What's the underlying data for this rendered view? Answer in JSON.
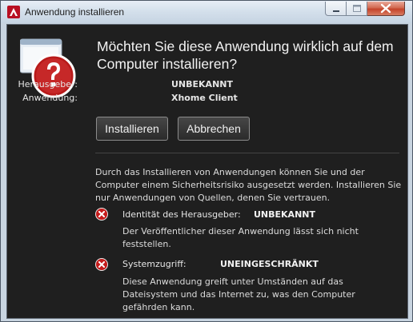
{
  "window": {
    "title": "Anwendung installieren"
  },
  "dialog": {
    "headline": "Möchten Sie diese Anwendung wirklich auf dem Computer installieren?",
    "publisher_label": "Herausgeber:",
    "publisher_value": "UNBEKANNT",
    "application_label": "Anwendung:",
    "application_value": "Xhome Client",
    "install_button": "Installieren",
    "cancel_button": "Abbrechen",
    "risk_text": "Durch das Installieren von Anwendungen können Sie und der Computer einem Sicherheitsrisiko ausgesetzt werden. Installieren Sie nur Anwendungen von Quellen, denen Sie vertrauen.",
    "warnings": [
      {
        "title": "Identität des Herausgeber:",
        "value": "UNBEKANNT",
        "description": "Der Veröffentlicher dieser Anwendung lässt sich nicht feststellen."
      },
      {
        "title": "Systemzugriff:",
        "value": "UNEINGESCHRÄNKT",
        "description": "Diese Anwendung greift unter Umständen auf das Dateisystem und das Internet zu, was den Computer gefährden kann."
      }
    ]
  },
  "colors": {
    "dialog_bg": "#1f1f1f",
    "error_red": "#c41a1a",
    "accent_brand": "#c8102e"
  },
  "icons": {
    "app": "adobe-air-icon",
    "hero": "question-mark-warning-icon",
    "warning": "error-x-icon"
  }
}
